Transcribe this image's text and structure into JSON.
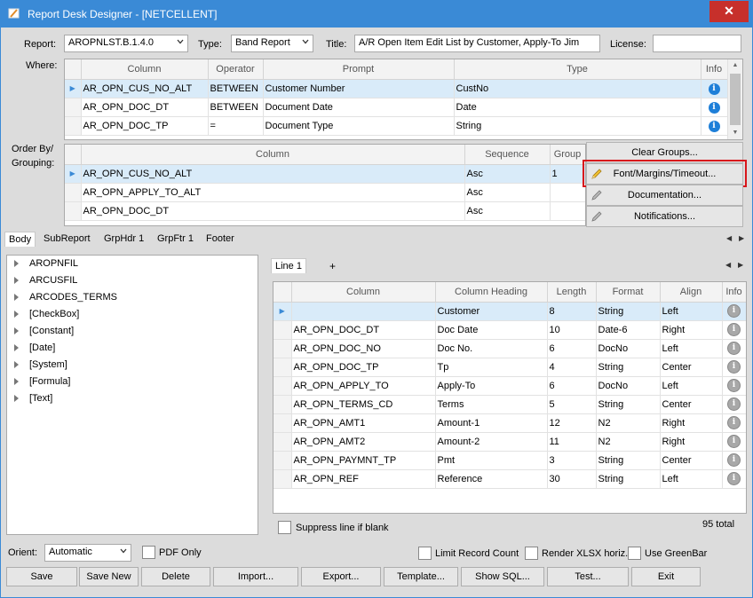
{
  "window": {
    "title": "Report Desk Designer - [NETCELLENT]",
    "close_glyph": "✕"
  },
  "header": {
    "report_label": "Report:",
    "report_value": "AROPNLST.B.1.4.0",
    "type_label": "Type:",
    "type_value": "Band Report",
    "title_label": "Title:",
    "title_value": "A/R Open Item Edit List by Customer, Apply-To Jim",
    "license_label": "License:",
    "license_value": ""
  },
  "where": {
    "label": "Where:",
    "columns": [
      "Column",
      "Operator",
      "Prompt",
      "Type",
      "Info"
    ],
    "rows": [
      {
        "column": "AR_OPN_CUS_NO_ALT",
        "operator": "BETWEEN",
        "prompt": "Customer Number",
        "type": "CustNo"
      },
      {
        "column": "AR_OPN_DOC_DT",
        "operator": "BETWEEN",
        "prompt": "Document Date",
        "type": "Date"
      },
      {
        "column": "AR_OPN_DOC_TP",
        "operator": "=",
        "prompt": "Document Type",
        "type": "String"
      }
    ]
  },
  "order": {
    "label_line1": "Order By/",
    "label_line2": "Grouping:",
    "columns": [
      "Column",
      "Sequence",
      "Group"
    ],
    "rows": [
      {
        "column": "AR_OPN_CUS_NO_ALT",
        "sequence": "Asc",
        "group": "1"
      },
      {
        "column": "AR_OPN_APPLY_TO_ALT",
        "sequence": "Asc",
        "group": ""
      },
      {
        "column": "AR_OPN_DOC_DT",
        "sequence": "Asc",
        "group": ""
      }
    ]
  },
  "side_buttons": {
    "clear_groups": "Clear Groups...",
    "font_margins": "Font/Margins/Timeout...",
    "documentation": "Documentation...",
    "notifications": "Notifications..."
  },
  "section_tabs": [
    "Body",
    "SubReport",
    "GrpHdr 1",
    "GrpFtr 1",
    "Footer"
  ],
  "tree_items": [
    "AROPNFIL",
    "ARCUSFIL",
    "ARCODES_TERMS",
    "[CheckBox]",
    "[Constant]",
    "[Date]",
    "[System]",
    "[Formula]",
    "[Text]"
  ],
  "line_tabs": {
    "active": "Line 1",
    "add": "+"
  },
  "fields": {
    "columns": [
      "Column",
      "Column Heading",
      "Length",
      "Format",
      "Align",
      "Info"
    ],
    "rows": [
      {
        "column": "",
        "heading": "Customer",
        "length": "8",
        "format": "String",
        "align": "Left"
      },
      {
        "column": "AR_OPN_DOC_DT",
        "heading": "Doc Date",
        "length": "10",
        "format": "Date-6",
        "align": "Right"
      },
      {
        "column": "AR_OPN_DOC_NO",
        "heading": "Doc No.",
        "length": "6",
        "format": "DocNo",
        "align": "Left"
      },
      {
        "column": "AR_OPN_DOC_TP",
        "heading": "Tp",
        "length": "4",
        "format": "String",
        "align": "Center"
      },
      {
        "column": "AR_OPN_APPLY_TO",
        "heading": "Apply-To",
        "length": "6",
        "format": "DocNo",
        "align": "Left"
      },
      {
        "column": "AR_OPN_TERMS_CD",
        "heading": "Terms",
        "length": "5",
        "format": "String",
        "align": "Center"
      },
      {
        "column": "AR_OPN_AMT1",
        "heading": "Amount-1",
        "length": "12",
        "format": "N2",
        "align": "Right"
      },
      {
        "column": "AR_OPN_AMT2",
        "heading": "Amount-2",
        "length": "11",
        "format": "N2",
        "align": "Right"
      },
      {
        "column": "AR_OPN_PAYMNT_TP",
        "heading": "Pmt",
        "length": "3",
        "format": "String",
        "align": "Center"
      },
      {
        "column": "AR_OPN_REF",
        "heading": "Reference",
        "length": "30",
        "format": "String",
        "align": "Left"
      }
    ],
    "suppress_label": "Suppress line if blank",
    "total": "95 total"
  },
  "options": {
    "orient_label": "Orient:",
    "orient_value": "Automatic",
    "pdf_only": "PDF Only",
    "limit_record_count": "Limit Record Count",
    "render_xlsx": "Render XLSX horiz.",
    "use_greenbar": "Use GreenBar"
  },
  "buttons": [
    "Save",
    "Save New",
    "Delete",
    "Import...",
    "Export...",
    "Template...",
    "Show SQL...",
    "Test...",
    "Exit"
  ],
  "colors": {
    "titlebar": "#3a8ad6",
    "selection": "#d9ebf9",
    "highlight": "#d8161b",
    "info": "#1e7fd8"
  }
}
